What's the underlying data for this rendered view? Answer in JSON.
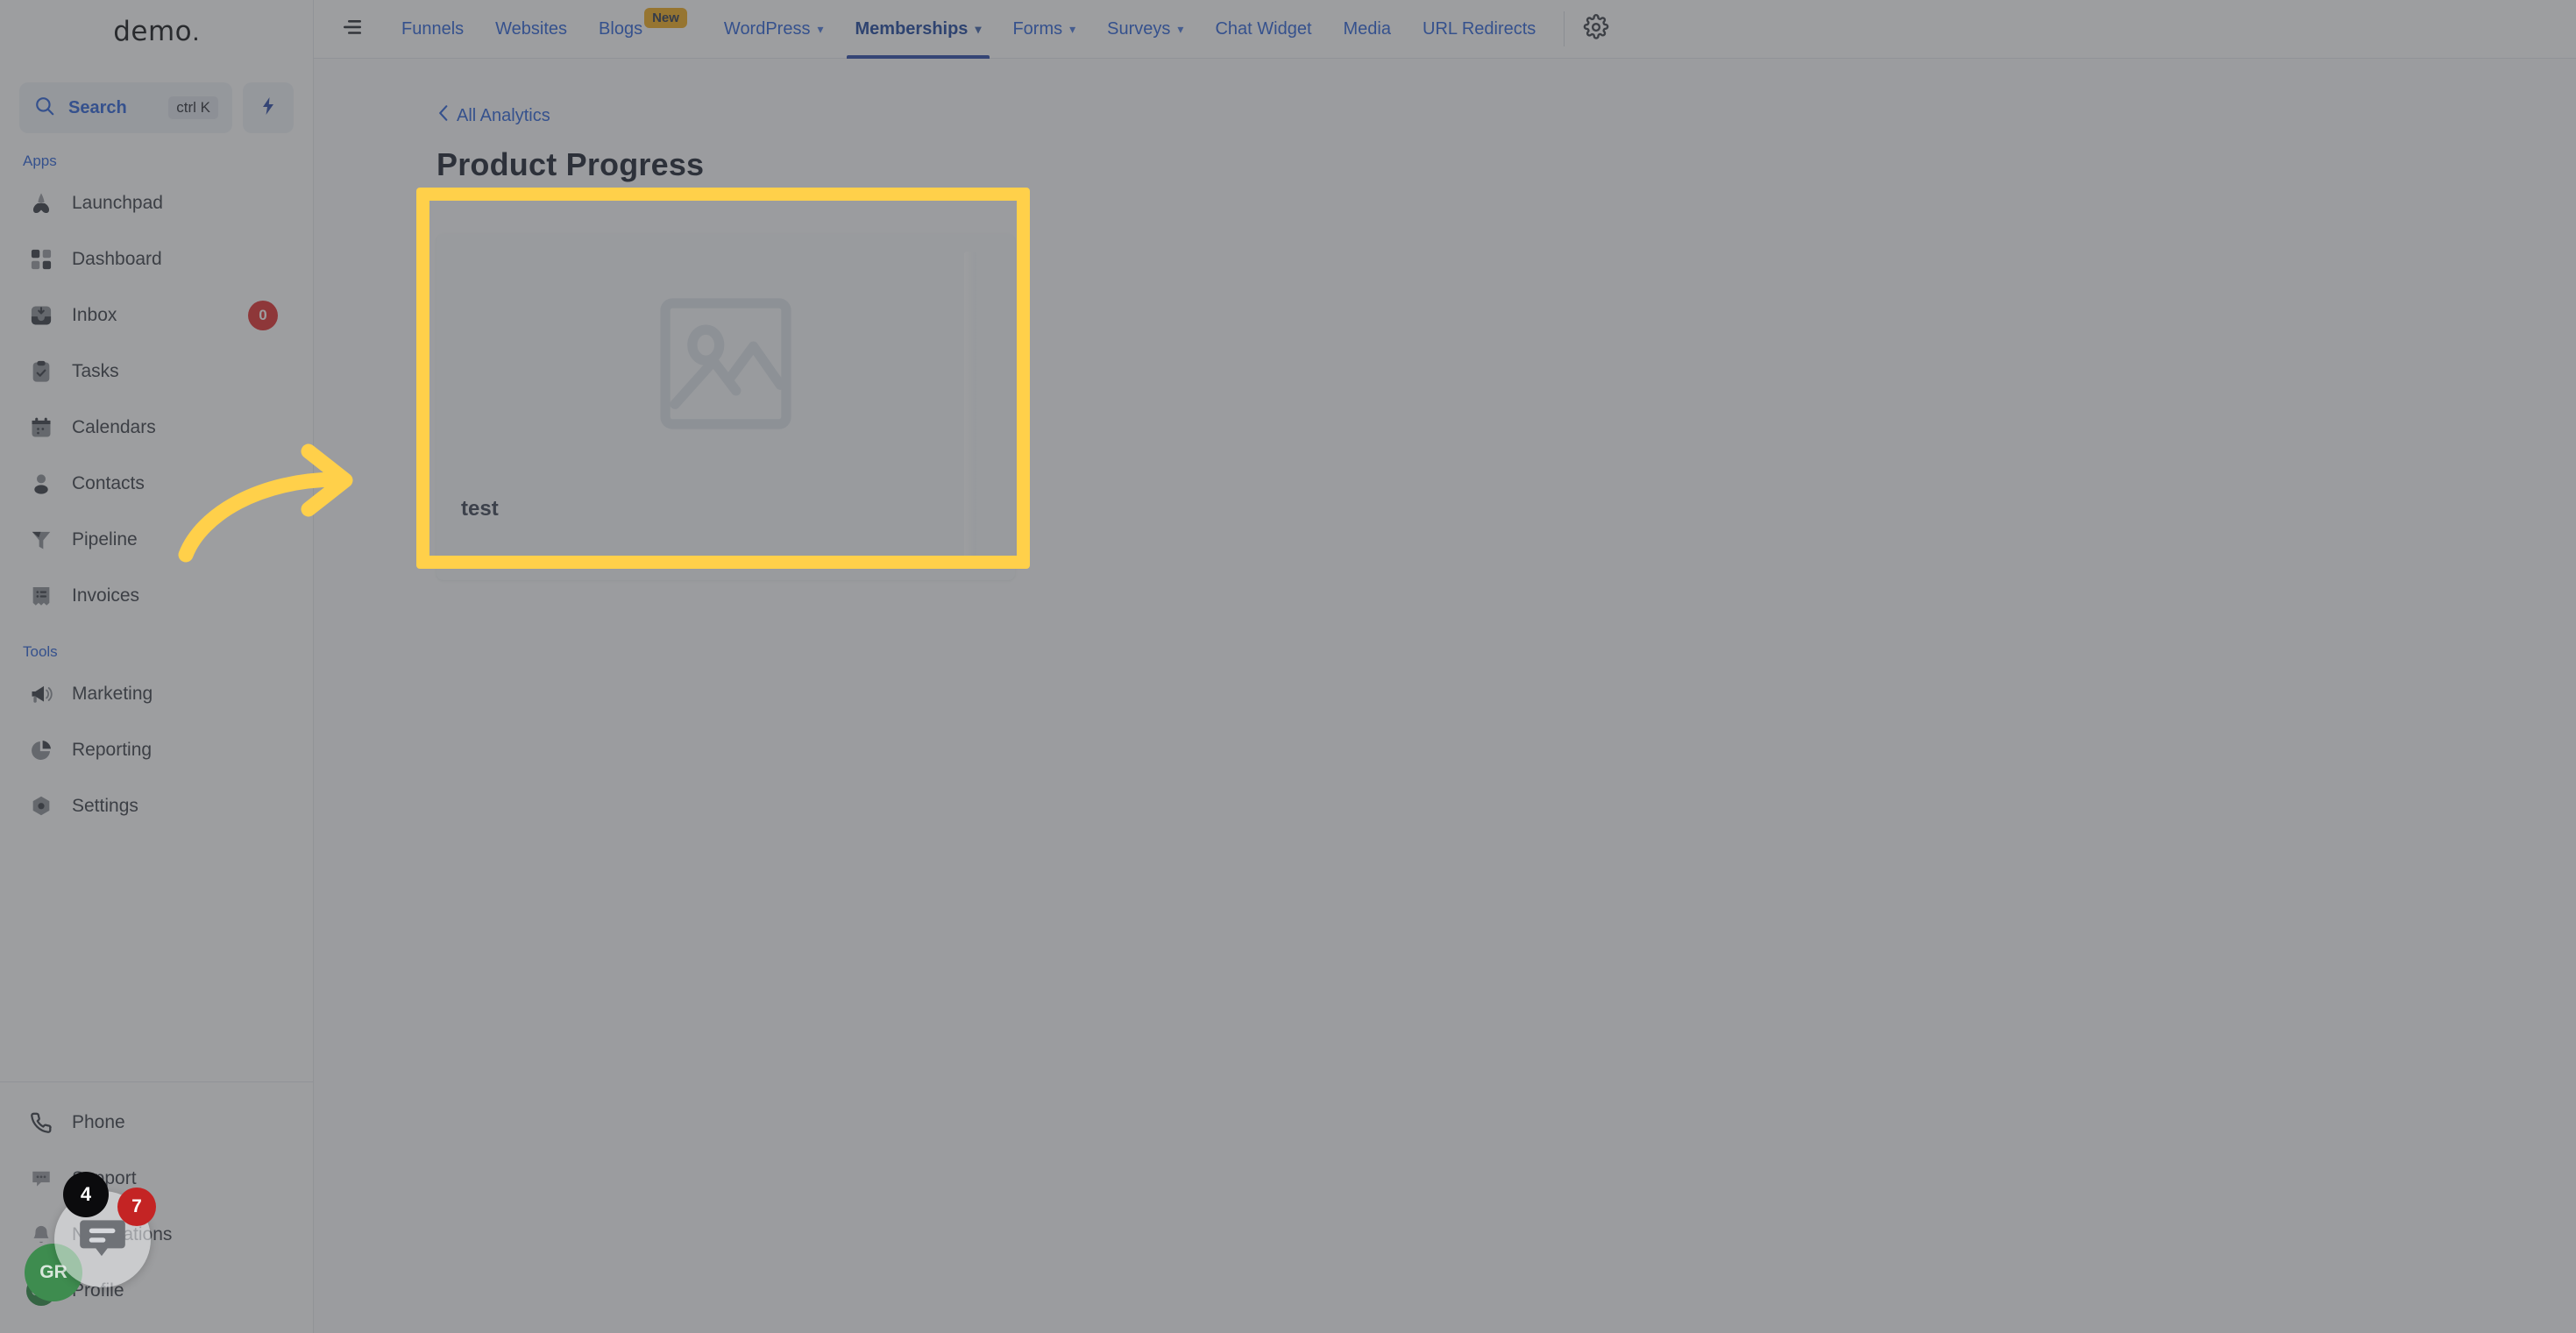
{
  "brand": {
    "name": "demo",
    "dot": "."
  },
  "search": {
    "label": "Search",
    "shortcut": "ctrl K",
    "icon": "search-icon",
    "bolt_icon": "lightning-bolt-icon"
  },
  "sidebar": {
    "sections": [
      {
        "title": "Apps",
        "items": [
          {
            "label": "Launchpad",
            "icon": "rocket-icon",
            "badge": null
          },
          {
            "label": "Dashboard",
            "icon": "grid-icon",
            "badge": null
          },
          {
            "label": "Inbox",
            "icon": "inbox-icon",
            "badge": "0"
          },
          {
            "label": "Tasks",
            "icon": "clipboard-check-icon",
            "badge": null
          },
          {
            "label": "Calendars",
            "icon": "calendar-icon",
            "badge": null
          },
          {
            "label": "Contacts",
            "icon": "person-icon",
            "badge": null
          },
          {
            "label": "Pipeline",
            "icon": "funnel-icon",
            "badge": null
          },
          {
            "label": "Invoices",
            "icon": "invoice-icon",
            "badge": null
          }
        ]
      },
      {
        "title": "Tools",
        "items": [
          {
            "label": "Marketing",
            "icon": "megaphone-icon",
            "badge": null
          },
          {
            "label": "Reporting",
            "icon": "pie-chart-icon",
            "badge": null
          },
          {
            "label": "Settings",
            "icon": "gear-hexagon-icon",
            "badge": null
          }
        ]
      }
    ],
    "bottom_items": [
      {
        "label": "Phone",
        "icon": "phone-icon"
      },
      {
        "label": "Support",
        "icon": "chat-dots-icon"
      },
      {
        "label": "Notifications",
        "icon": "bell-icon"
      },
      {
        "label": "Profile",
        "icon": "avatar-icon",
        "avatar_initials": "GR"
      }
    ]
  },
  "topnav": {
    "collapse_icon": "collapse-menu-icon",
    "gear_icon": "gear-icon",
    "tabs": [
      {
        "label": "Funnels",
        "caret": false,
        "badge": null,
        "active": false
      },
      {
        "label": "Websites",
        "caret": false,
        "badge": null,
        "active": false
      },
      {
        "label": "Blogs",
        "caret": false,
        "badge": "New",
        "active": false
      },
      {
        "label": "WordPress",
        "caret": true,
        "badge": null,
        "active": false
      },
      {
        "label": "Memberships",
        "caret": true,
        "badge": null,
        "active": true
      },
      {
        "label": "Forms",
        "caret": true,
        "badge": null,
        "active": false
      },
      {
        "label": "Surveys",
        "caret": true,
        "badge": null,
        "active": false
      },
      {
        "label": "Chat Widget",
        "caret": false,
        "badge": null,
        "active": false
      },
      {
        "label": "Media",
        "caret": false,
        "badge": null,
        "active": false
      },
      {
        "label": "URL Redirects",
        "caret": false,
        "badge": null,
        "active": false
      }
    ]
  },
  "content": {
    "breadcrumb": "All Analytics",
    "breadcrumb_icon": "chevron-left-icon",
    "page_title": "Product Progress",
    "cards": [
      {
        "title": "test",
        "thumb_icon": "image-placeholder-icon"
      }
    ]
  },
  "chat_widget": {
    "icon": "chat-bubble-icon",
    "unread_badge": "7",
    "secondary_badge": "4",
    "avatar_initials": "GR"
  },
  "annotation": {
    "highlight_color": "#FFD04A",
    "arrow_icon": "curved-arrow-right-icon"
  }
}
